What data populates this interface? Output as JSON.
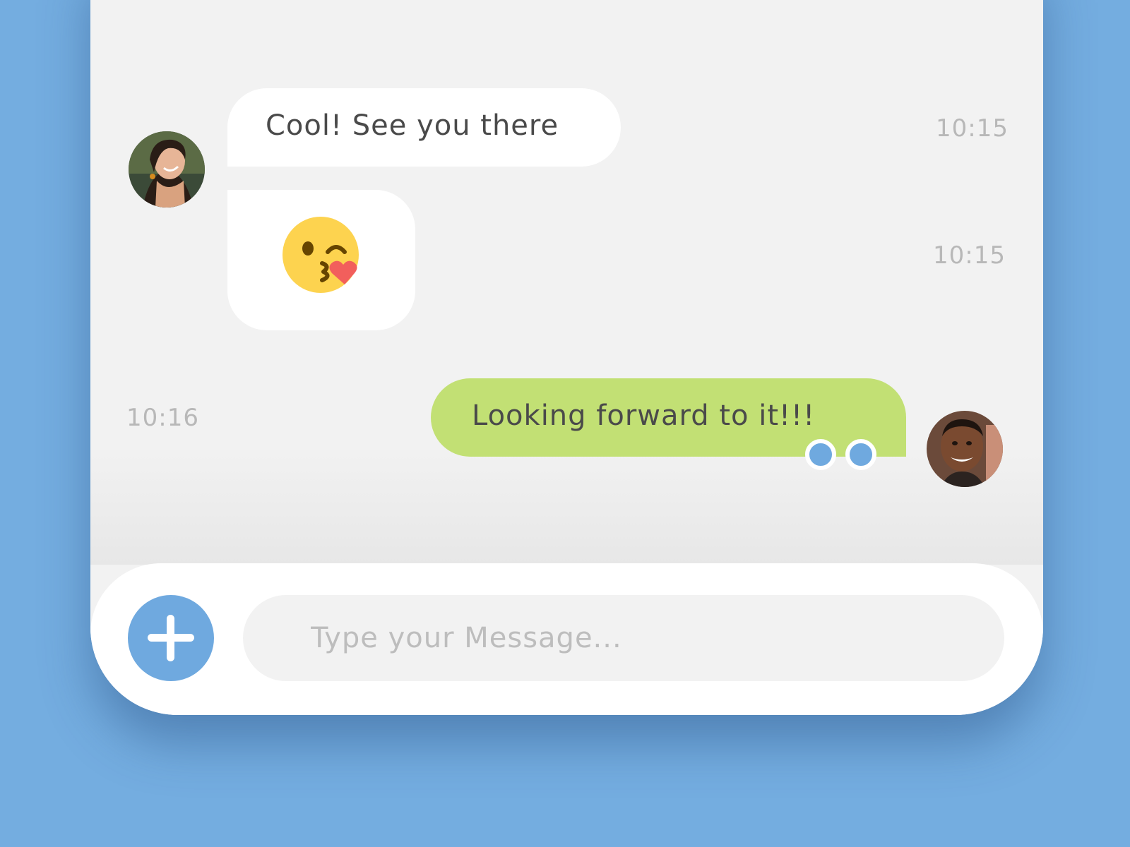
{
  "conversation": {
    "messages": [
      {
        "sender": "contact",
        "text": "Cool! See you there",
        "time": "10:15"
      },
      {
        "sender": "contact",
        "type": "emoji",
        "emoji": "kissing-heart-emoji",
        "time": "10:15"
      },
      {
        "sender": "me",
        "text": "Looking forward to it!!!",
        "time": "10:16",
        "read_receipts": 2
      }
    ]
  },
  "composer": {
    "placeholder": "Type your Message...",
    "add_icon": "plus-icon"
  },
  "colors": {
    "background": "#74ade0",
    "accent": "#6fa9df",
    "sent_bubble": "#c2e074",
    "received_bubble": "#ffffff",
    "chat_background": "#f2f2f2",
    "timestamp": "#b8b8b8"
  }
}
